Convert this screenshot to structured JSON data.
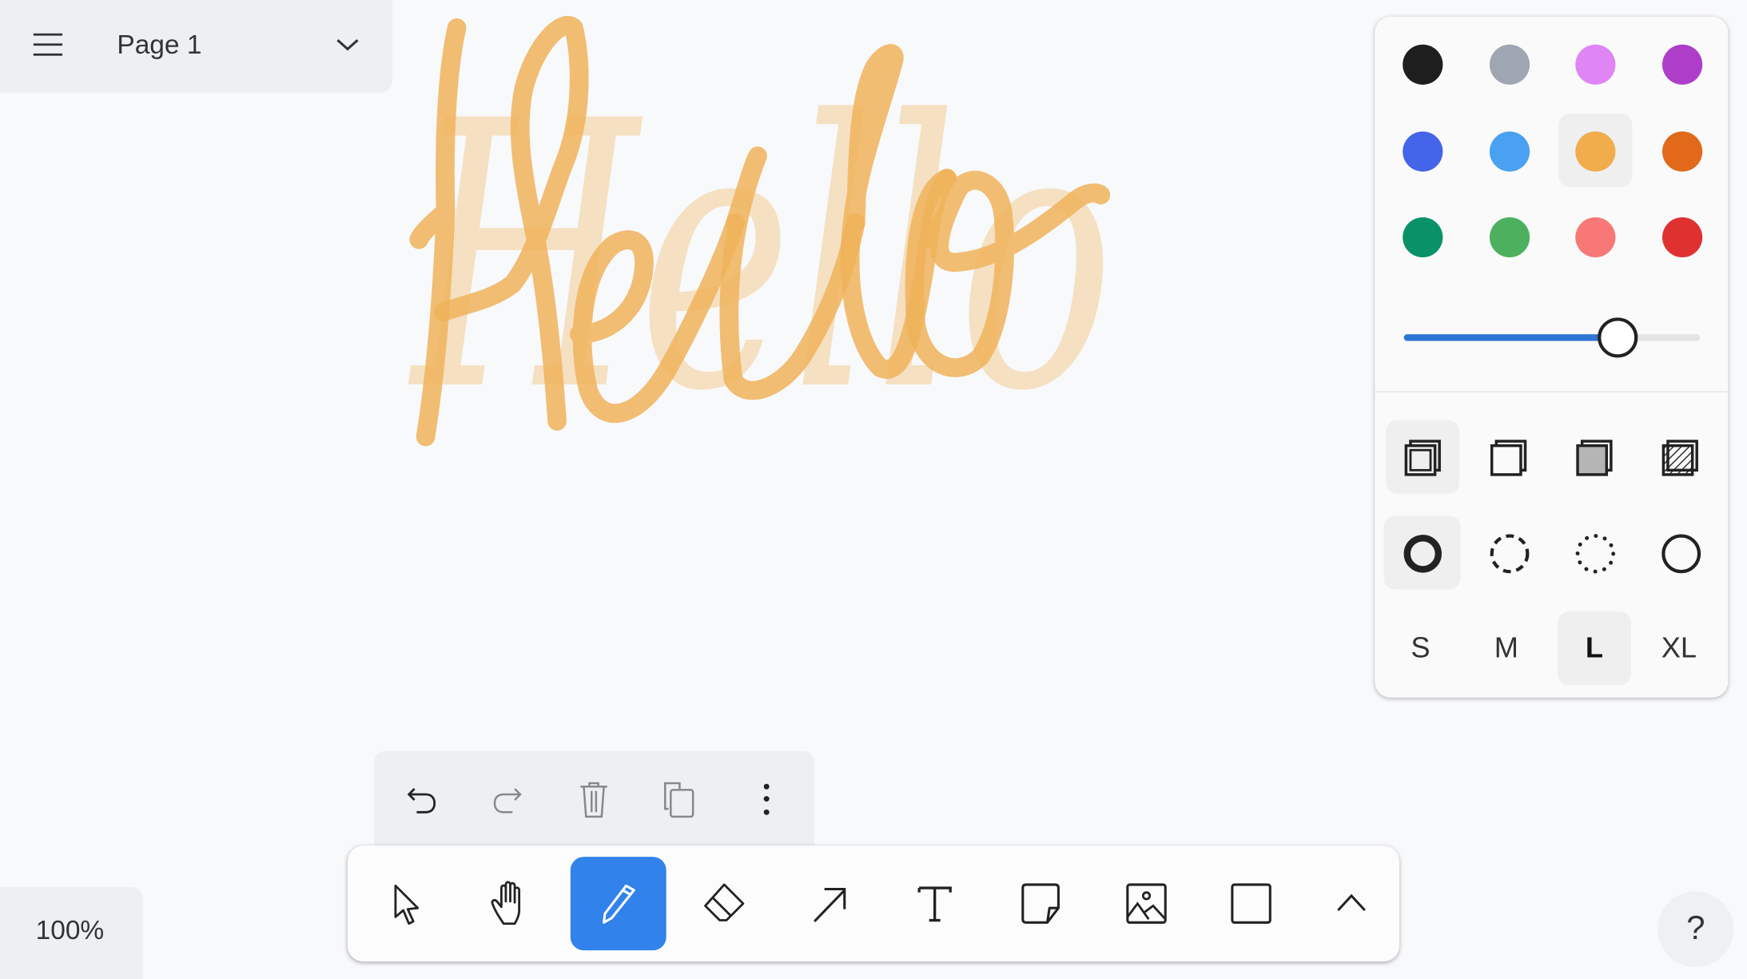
{
  "page_menu": {
    "title": "Page 1"
  },
  "canvas": {
    "drawing_text": "Hello",
    "stroke_color": "#f0b35a"
  },
  "style_panel": {
    "colors": [
      "#1e1e1e",
      "#9ea7b1",
      "#e085f4",
      "#ae3ec9",
      "#4465e9",
      "#4ba1f1",
      "#f1ac4b",
      "#e16919",
      "#099268",
      "#4cb05e",
      "#f87777",
      "#e03131"
    ],
    "selected_color_index": 6,
    "opacity_percent": 72,
    "fill_styles": [
      "none",
      "semi",
      "solid",
      "pattern"
    ],
    "selected_fill": 0,
    "dash_styles": [
      "draw",
      "dashed",
      "dotted",
      "solid"
    ],
    "selected_dash": 0,
    "sizes": [
      "S",
      "M",
      "L",
      "XL"
    ],
    "selected_size": 2,
    "accent": "#2e75d6"
  },
  "zoom": {
    "level": "100%"
  },
  "help": {
    "label": "?"
  },
  "tools": [
    "select",
    "hand",
    "draw",
    "eraser",
    "arrow",
    "text",
    "note",
    "image",
    "rectangle",
    "more"
  ],
  "active_tool": "draw",
  "tool_accent": "#3182ea"
}
